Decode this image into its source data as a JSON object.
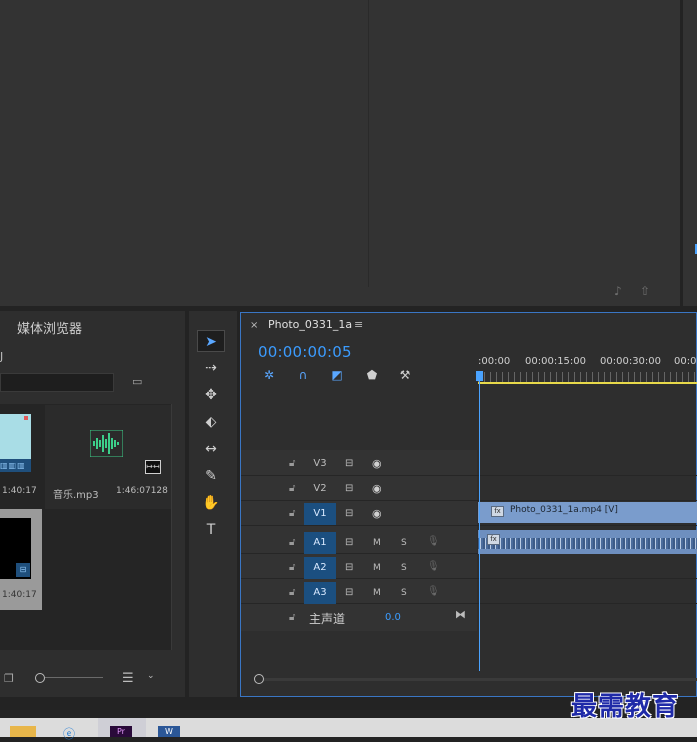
{
  "project_panel": {
    "tab_title": "媒体浏览器",
    "fragment_label": "J",
    "items": [
      {
        "badge": "▥▥▥",
        "duration": "1:40:17"
      },
      {
        "name": "音乐.mp3",
        "duration": "1:46:07128",
        "badge": "↦↤"
      },
      {
        "badge": "⊟",
        "duration": "1:40:17"
      }
    ]
  },
  "monitor": {
    "icons": [
      "export-audio-icon",
      "export-frame-icon"
    ]
  },
  "timeline": {
    "close": "×",
    "sequence_name": "Photo_0331_1a",
    "menu": "≡",
    "timecode": "00:00:00:05",
    "ruler_labels": [
      ":00:00",
      "00:00:15:00",
      "00:00:30:00",
      "00:0"
    ],
    "tracks": [
      {
        "name": "V3",
        "active": false,
        "type": "video"
      },
      {
        "name": "V2",
        "active": false,
        "type": "video"
      },
      {
        "name": "V1",
        "active": true,
        "type": "video"
      },
      {
        "name": "A1",
        "active": true,
        "type": "audio"
      },
      {
        "name": "A2",
        "active": true,
        "type": "audio"
      },
      {
        "name": "A3",
        "active": true,
        "type": "audio"
      }
    ],
    "mute_label": "M",
    "solo_label": "S",
    "video_clip_label": "Photo_0331_1a.mp4 [V]",
    "fx_label": "fx",
    "master": {
      "label": "主声道",
      "value": "0.0"
    }
  },
  "taskbar": {
    "pr_label": "Pr",
    "word_label": "W"
  },
  "watermark": "最需教育",
  "colors": {
    "accent": "#3b9cff",
    "panel": "#2e2e2e",
    "clip_video": "#7a9ccc",
    "clip_audio": "#6e8fbf",
    "workarea": "#e8d94a"
  }
}
